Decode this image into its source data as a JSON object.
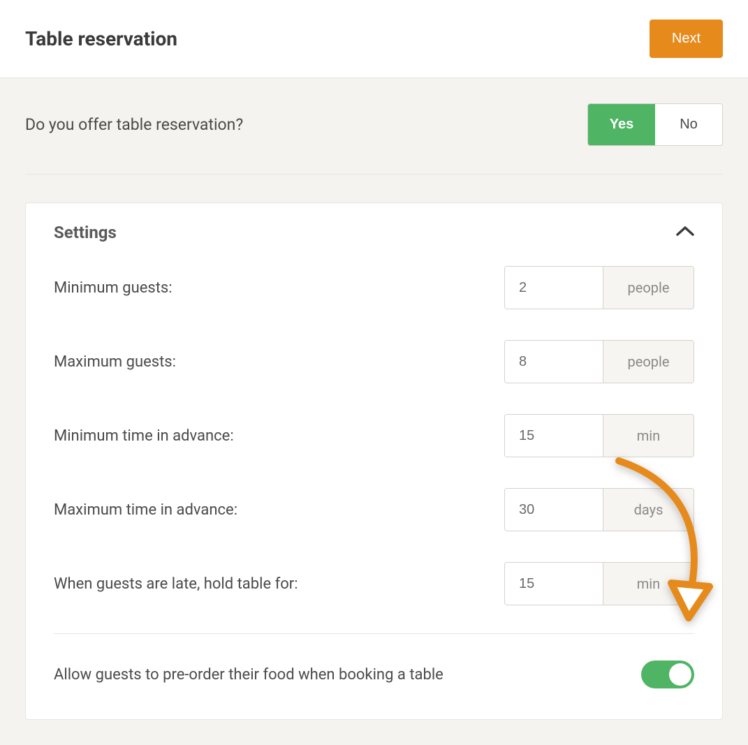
{
  "header": {
    "title": "Table reservation",
    "next_button_label": "Next"
  },
  "question": {
    "text": "Do you offer table reservation?",
    "yes_label": "Yes",
    "no_label": "No",
    "selected": "yes"
  },
  "settings": {
    "title": "Settings",
    "rows": {
      "min_guests": {
        "label": "Minimum guests:",
        "value": "2",
        "unit": "people"
      },
      "max_guests": {
        "label": "Maximum guests:",
        "value": "8",
        "unit": "people"
      },
      "min_advance": {
        "label": "Minimum time in advance:",
        "value": "15",
        "unit": "min"
      },
      "max_advance": {
        "label": "Maximum time in advance:",
        "value": "30",
        "unit": "days"
      },
      "hold_table": {
        "label": "When guests are late, hold table for:",
        "value": "15",
        "unit": "min"
      }
    },
    "preorder": {
      "label": "Allow guests to pre-order their food when booking a table",
      "enabled": true
    }
  },
  "colors": {
    "accent_orange": "#e68a1c",
    "accent_green": "#4fb464"
  }
}
